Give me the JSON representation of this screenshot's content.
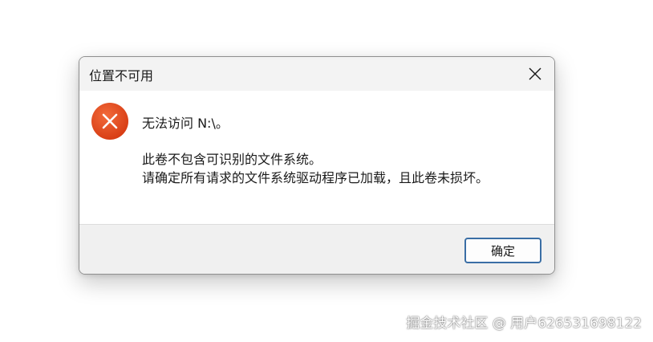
{
  "dialog": {
    "title": "位置不可用",
    "close_icon": "close-icon",
    "error_icon": "error-x-icon",
    "colors": {
      "error_red": "#e8491d",
      "titlebar_bg": "#f3f3f3",
      "footer_bg": "#f0f0f0",
      "button_border": "#3a6ea5"
    },
    "message_main": "无法访问 N:\\。",
    "message_detail_line1": "此卷不包含可识别的文件系统。",
    "message_detail_line2": "请确定所有请求的文件系统驱动程序已加载，且此卷未损坏。",
    "ok_label": "确定"
  },
  "watermark": "掘金技术社区 @ 用户626531698122"
}
